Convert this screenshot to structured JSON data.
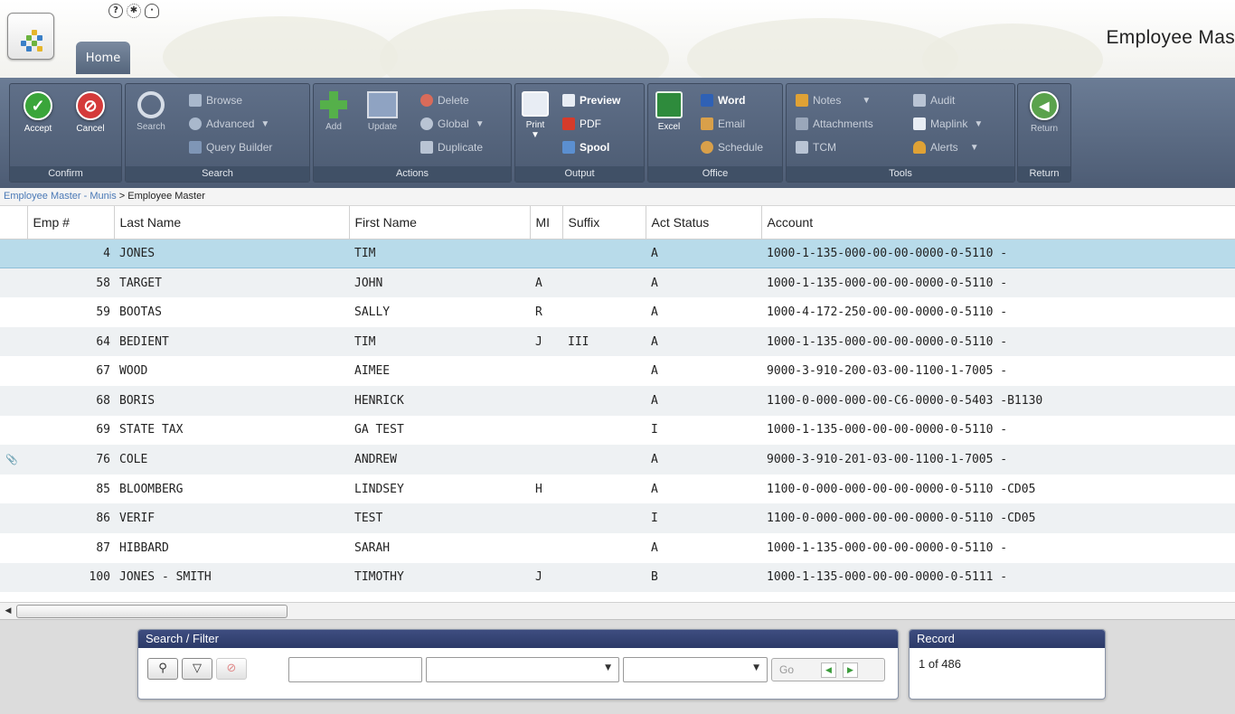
{
  "header": {
    "title": "Employee Mas",
    "tab_home": "Home",
    "icons": [
      "help-icon",
      "settings-gear-icon",
      "lightbulb-icon"
    ]
  },
  "ribbon": {
    "confirm": {
      "label": "Confirm",
      "accept": "Accept",
      "cancel": "Cancel"
    },
    "search": {
      "label": "Search",
      "search": "Search",
      "browse": "Browse",
      "advanced": "Advanced",
      "query_builder": "Query Builder"
    },
    "actions": {
      "label": "Actions",
      "add": "Add",
      "update": "Update",
      "delete": "Delete",
      "global": "Global",
      "duplicate": "Duplicate"
    },
    "output": {
      "label": "Output",
      "print": "Print",
      "preview": "Preview",
      "pdf": "PDF",
      "spool": "Spool"
    },
    "office": {
      "label": "Office",
      "excel": "Excel",
      "word": "Word",
      "email": "Email",
      "schedule": "Schedule"
    },
    "tools": {
      "label": "Tools",
      "notes": "Notes",
      "attachments": "Attachments",
      "tcm": "TCM",
      "audit": "Audit",
      "maplink": "Maplink",
      "alerts": "Alerts"
    },
    "return": {
      "label": "Return",
      "return": "Return"
    }
  },
  "breadcrumb": {
    "link": "Employee Master - Munis",
    "separator": ">",
    "current": "Employee Master"
  },
  "grid": {
    "columns": [
      "Emp #",
      "Last Name",
      "First Name",
      "MI",
      "Suffix",
      "Act Status",
      "Account"
    ],
    "rows": [
      {
        "flag": "",
        "emp": "4",
        "last": "JONES",
        "first": "TIM",
        "mi": "",
        "suffix": "",
        "status": "A",
        "account": "1000-1-135-000-00-00-0000-0-5110  -",
        "selected": true
      },
      {
        "flag": "",
        "emp": "58",
        "last": "TARGET",
        "first": "JOHN",
        "mi": "A",
        "suffix": "",
        "status": "A",
        "account": "1000-1-135-000-00-00-0000-0-5110  -"
      },
      {
        "flag": "",
        "emp": "59",
        "last": "BOOTAS",
        "first": "SALLY",
        "mi": "R",
        "suffix": "",
        "status": "A",
        "account": "1000-4-172-250-00-00-0000-0-5110  -"
      },
      {
        "flag": "",
        "emp": "64",
        "last": "BEDIENT",
        "first": "TIM",
        "mi": "J",
        "suffix": "III",
        "status": "A",
        "account": "1000-1-135-000-00-00-0000-0-5110  -"
      },
      {
        "flag": "",
        "emp": "67",
        "last": "WOOD",
        "first": "AIMEE",
        "mi": "",
        "suffix": "",
        "status": "A",
        "account": "9000-3-910-200-03-00-1100-1-7005  -"
      },
      {
        "flag": "",
        "emp": "68",
        "last": "BORIS",
        "first": "HENRICK",
        "mi": "",
        "suffix": "",
        "status": "A",
        "account": "1100-0-000-000-00-C6-0000-0-5403  -B1130"
      },
      {
        "flag": "",
        "emp": "69",
        "last": "STATE TAX",
        "first": "GA TEST",
        "mi": "",
        "suffix": "",
        "status": "I",
        "account": "1000-1-135-000-00-00-0000-0-5110  -"
      },
      {
        "flag": "paperclip-icon",
        "emp": "76",
        "last": "COLE",
        "first": "ANDREW",
        "mi": "",
        "suffix": "",
        "status": "A",
        "account": "9000-3-910-201-03-00-1100-1-7005  -"
      },
      {
        "flag": "",
        "emp": "85",
        "last": "BLOOMBERG",
        "first": "LINDSEY",
        "mi": "H",
        "suffix": "",
        "status": "A",
        "account": "1100-0-000-000-00-00-0000-0-5110  -CD05"
      },
      {
        "flag": "",
        "emp": "86",
        "last": "VERIF",
        "first": "TEST",
        "mi": "",
        "suffix": "",
        "status": "I",
        "account": "1100-0-000-000-00-00-0000-0-5110  -CD05"
      },
      {
        "flag": "",
        "emp": "87",
        "last": "HIBBARD",
        "first": "SARAH",
        "mi": "",
        "suffix": "",
        "status": "A",
        "account": "1000-1-135-000-00-00-0000-0-5110  -"
      },
      {
        "flag": "",
        "emp": "100",
        "last": "JONES - SMITH",
        "first": "TIMOTHY",
        "mi": "J",
        "suffix": "",
        "status": "B",
        "account": "1000-1-135-000-00-00-0000-0-5111  -"
      }
    ]
  },
  "search_filter": {
    "title": "Search / Filter",
    "input_value": "",
    "field1_value": "",
    "field2_value": "",
    "go": "Go"
  },
  "record": {
    "title": "Record",
    "text": "1 of 486"
  },
  "colors": {
    "ribbon": "#5a6a83",
    "selected_row": "#b8dbea",
    "panel_header": "#34437a",
    "accept_green": "#3aa53a",
    "cancel_red": "#d43a3a"
  }
}
